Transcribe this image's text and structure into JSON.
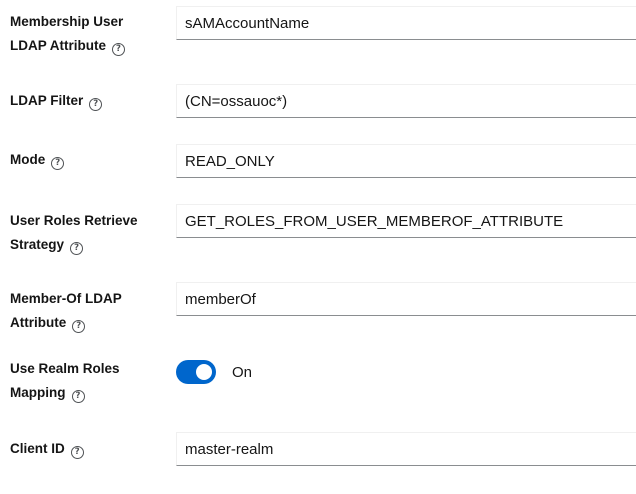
{
  "fields": [
    {
      "label_line1": "Membership User",
      "label_line2": "LDAP Attribute",
      "value": "sAMAccountName"
    },
    {
      "label_line1": "LDAP Filter",
      "value": "(CN=ossauoc*)"
    },
    {
      "label_line1": "Mode",
      "value": "READ_ONLY"
    },
    {
      "label_line1": "User Roles Retrieve",
      "label_line2": "Strategy",
      "value": "GET_ROLES_FROM_USER_MEMBEROF_ATTRIBUTE"
    },
    {
      "label_line1": "Member-Of LDAP",
      "label_line2": "Attribute",
      "value": "memberOf"
    },
    {
      "label_line1": "Use Realm Roles",
      "label_line2": "Mapping",
      "toggle_state": "On",
      "toggle_on": true
    },
    {
      "label_line1": "Client ID",
      "value": "master-realm"
    }
  ],
  "help_icon_glyph": "?",
  "colors": {
    "accent": "#0066cc",
    "text": "#151515",
    "input_border_bottom": "#8a8d90"
  },
  "icons": {
    "help": "help-circle-icon"
  }
}
